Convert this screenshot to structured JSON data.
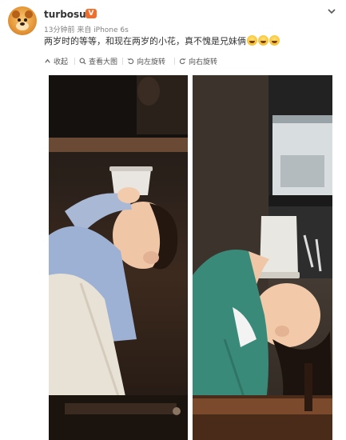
{
  "post": {
    "username": "turbosun",
    "badge": "V",
    "meta": "13分钟前 来自 iPhone 6s",
    "caption": "两岁时的等等，和现在两岁的小花，真不愧是兄妹俩"
  },
  "toolbar": {
    "collect": "收起",
    "view_large": "查看大图",
    "rotate_left": "向左旋转",
    "rotate_right": "向右旋转"
  },
  "photo": {
    "left_panel": "toddler boy drinking from a cup held upside-down over his face",
    "right_panel": "toddler girl drinking from a cup held upside-down over her face"
  },
  "colors": {
    "accent": "#f26d2a",
    "meta_text": "#808080"
  }
}
